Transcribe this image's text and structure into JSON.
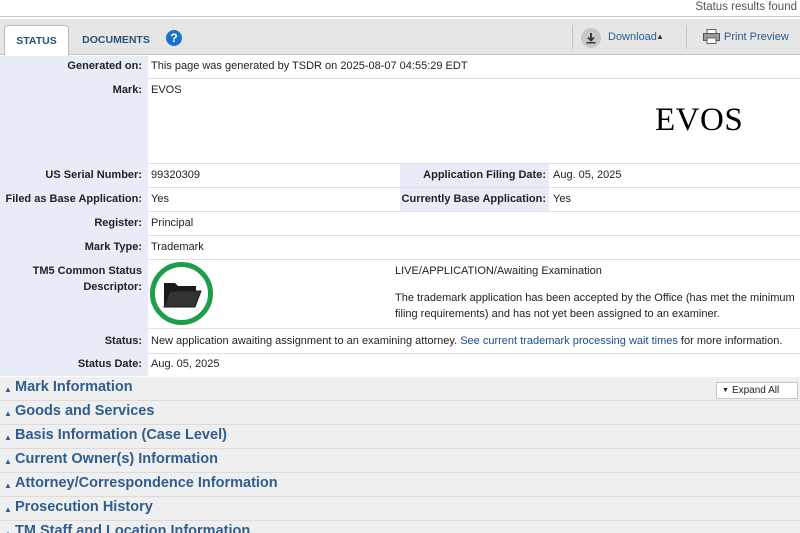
{
  "header": {
    "status_found": "Status results found"
  },
  "tabs": [
    {
      "label": "STATUS",
      "active": true
    },
    {
      "label": "DOCUMENTS",
      "active": false
    }
  ],
  "toolbar": {
    "download_label": "Download",
    "print_label": "Print Preview",
    "help_icon": "?"
  },
  "details": {
    "generated_on": {
      "label": "Generated on:",
      "value": "This page was generated by TSDR on 2025-08-07 04:55:29 EDT"
    },
    "mark": {
      "label": "Mark:",
      "value": "EVOS",
      "image_text": "EVOS"
    },
    "serial": {
      "label": "US Serial Number:",
      "value": "99320309"
    },
    "filing_date": {
      "label": "Application Filing Date:",
      "value": "Aug. 05, 2025"
    },
    "filed_base": {
      "label": "Filed as Base Application:",
      "value": "Yes"
    },
    "currently_base": {
      "label": "Currently Base Application:",
      "value": "Yes"
    },
    "register": {
      "label": "Register:",
      "value": "Principal"
    },
    "mark_type": {
      "label": "Mark Type:",
      "value": "Trademark"
    },
    "tm5": {
      "label_line1": "TM5 Common Status",
      "label_line2": "Descriptor:",
      "status_line": "LIVE/APPLICATION/Awaiting Examination",
      "desc_line1": "The trademark application has been accepted by the Office (has met the minimum",
      "desc_line2": "filing requirements) and has not yet been assigned to an examiner.",
      "icon": "folder-icon",
      "circle_color": "#1e9e48"
    },
    "status": {
      "label": "Status:",
      "value_prefix": "New application awaiting assignment to an examining attorney.",
      "link_text": "See current trademark processing wait times",
      "value_suffix": "for more information."
    },
    "status_date": {
      "label": "Status Date:",
      "value": "Aug. 05, 2025"
    }
  },
  "sections": [
    "Mark Information",
    "Goods and Services",
    "Basis Information (Case Level)",
    "Current Owner(s) Information",
    "Attorney/Correspondence Information",
    "Prosecution History",
    "TM Staff and Location Information"
  ],
  "expand_all_label": "Expand All",
  "colors": {
    "label_bg": "#e8ecf6",
    "link": "#1a4e8a",
    "section_title": "#2f5d8e",
    "help": "#1a73c8"
  }
}
